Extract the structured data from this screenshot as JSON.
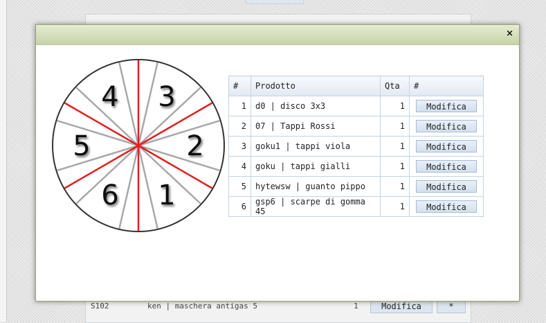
{
  "background": {
    "row": {
      "code": "S102",
      "product": "ken | maschera antigas 5",
      "qty": "1",
      "button": "Modifica",
      "extra": "*"
    }
  },
  "modal": {
    "close_label": "×",
    "wheel": {
      "numbers": [
        "1",
        "2",
        "3",
        "4",
        "5",
        "6"
      ],
      "colors": {
        "red_line": "#e02020",
        "gray_line": "#a8a8a8",
        "rim": "#333333"
      }
    },
    "table": {
      "headers": {
        "index": "#",
        "product": "Prodotto",
        "qty": "Qta",
        "action": "#"
      },
      "rows": [
        {
          "index": "1",
          "product": "d0 | disco 3x3",
          "qty": "1",
          "action": "Modifica"
        },
        {
          "index": "2",
          "product": "07 | Tappi Rossi",
          "qty": "1",
          "action": "Modifica"
        },
        {
          "index": "3",
          "product": "goku1 | tappi viola",
          "qty": "1",
          "action": "Modifica"
        },
        {
          "index": "4",
          "product": "goku | tappi gialli",
          "qty": "1",
          "action": "Modifica"
        },
        {
          "index": "5",
          "product": "hytewsw | guanto pippo",
          "qty": "1",
          "action": "Modifica"
        },
        {
          "index": "6",
          "product": "gsp6 | scarpe di gomma 45",
          "qty": "1",
          "action": "Modifica"
        }
      ]
    }
  }
}
